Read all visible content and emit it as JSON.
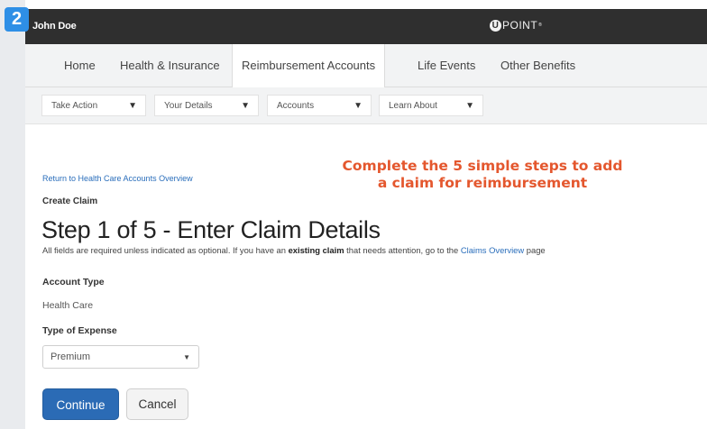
{
  "step_badge": "2",
  "header": {
    "user_name": "John Doe",
    "brand": {
      "mark": "U",
      "text": "POINT",
      "tm": "®"
    }
  },
  "nav": {
    "tabs": [
      {
        "label": "Home"
      },
      {
        "label": "Health & Insurance"
      },
      {
        "label": "Reimbursement Accounts",
        "active": true
      },
      {
        "label": "Life Events"
      },
      {
        "label": "Other Benefits"
      }
    ]
  },
  "subnav": {
    "menus": [
      {
        "label": "Take Action"
      },
      {
        "label": "Your Details"
      },
      {
        "label": "Accounts"
      },
      {
        "label": "Learn About"
      }
    ],
    "arrow_glyph": "▼"
  },
  "hint": {
    "line1": "Complete the 5 simple steps to add",
    "line2": "a claim for reimbursement"
  },
  "page": {
    "return_link": "Return to Health Care Accounts Overview",
    "section_label": "Create Claim",
    "title": "Step 1 of 5 - Enter Claim Details",
    "instructions": {
      "part1": "All fields are required unless indicated as optional. If you have an ",
      "emphasis": "existing claim",
      "part2": " that needs attention, go to the ",
      "link": "Claims Overview",
      "part3": " page"
    },
    "account_type_label": "Account Type",
    "account_type_value": "Health Care",
    "expense_label": "Type of Expense",
    "expense_value": "Premium"
  },
  "buttons": {
    "continue": "Continue",
    "cancel": "Cancel"
  },
  "colors": {
    "topbar": "#2f2f2f",
    "accent_badge": "#2e8fe6",
    "hint": "#e4572e",
    "primary_button": "#2b6bb5",
    "link": "#2a6ebb"
  }
}
